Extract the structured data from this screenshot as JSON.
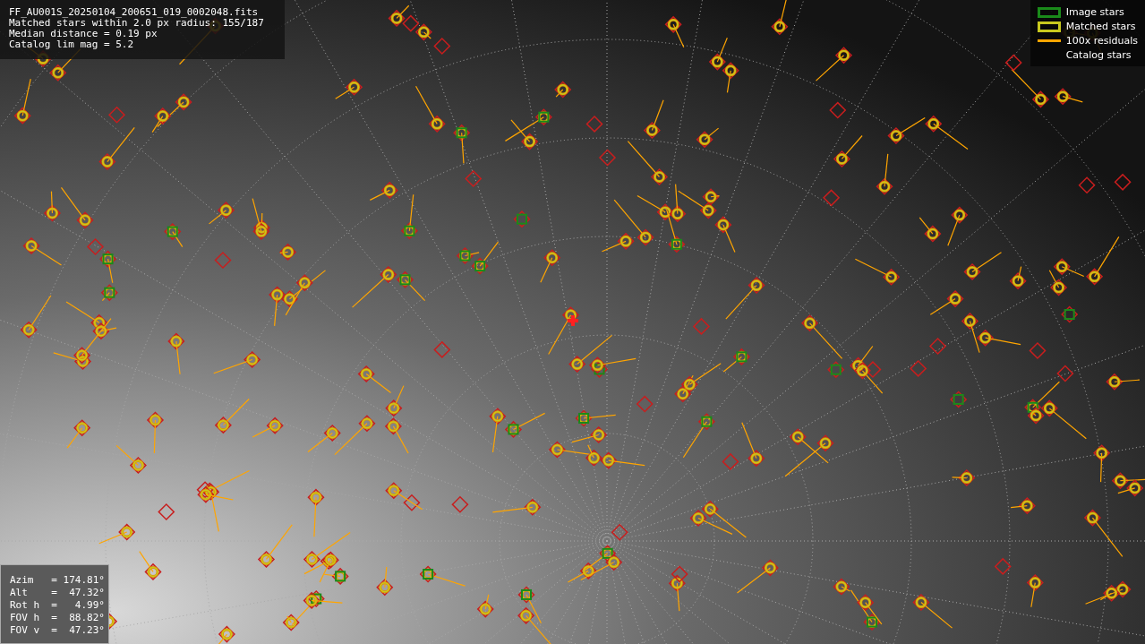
{
  "header": {
    "lines": [
      "FF_AU001S_20250104_200651_019_0002048.fits",
      "Matched stars within 2.0 px radius: 155/187",
      "Median distance = 0.19 px",
      "Catalog lim mag = 5.2"
    ]
  },
  "legend": [
    {
      "kind": "box",
      "color": "#1a8a1a",
      "label": "Image stars"
    },
    {
      "kind": "box",
      "color": "#c8c81e",
      "label": "Matched stars"
    },
    {
      "kind": "line",
      "color": "#ffa500",
      "label": "100x residuals"
    },
    {
      "kind": "none",
      "label": "Catalog stars"
    }
  ],
  "pointing": {
    "lines": [
      "Azim   = 174.81°",
      "Alt    =  47.32°",
      "Rot h  =   4.99°",
      "FOV h  =  88.82°",
      "FOV v  =  47.23°"
    ]
  }
}
